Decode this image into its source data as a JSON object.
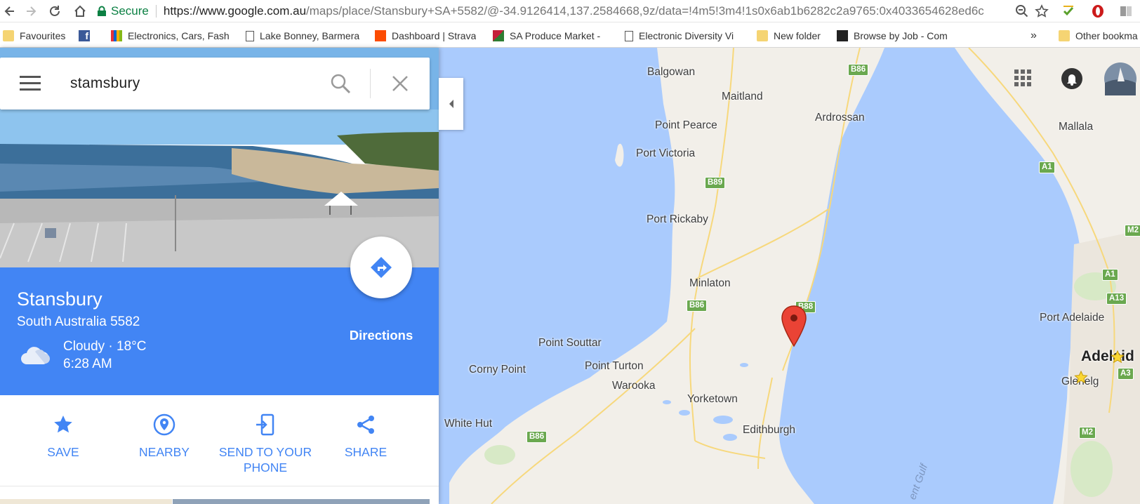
{
  "browser": {
    "url_secure_label": "Secure",
    "url_host": "https://www.google.com.au",
    "url_path": "/maps/place/Stansbury+SA+5582/@-34.9126414,137.2584668,9z/data=!4m5!3m4!1s0x6ab1b6282c2a9765:0x4033654628ed6c",
    "bookmarks": [
      {
        "label": "Favourites",
        "icon": "folder-icon"
      },
      {
        "label": "",
        "icon": "facebook-icon"
      },
      {
        "label": "Electronics, Cars, Fash",
        "icon": "ebay-icon"
      },
      {
        "label": "Lake Bonney, Barmera",
        "icon": "page-icon"
      },
      {
        "label": "Dashboard | Strava",
        "icon": "strava-icon"
      },
      {
        "label": "SA Produce Market - ",
        "icon": "produce-market-icon"
      },
      {
        "label": "Electronic Diversity Vi",
        "icon": "page-icon"
      },
      {
        "label": "New folder",
        "icon": "folder-icon"
      },
      {
        "label": "Browse by Job - Com",
        "icon": "job-site-icon"
      }
    ],
    "overflow_label": "»",
    "other_bookmarks": "Other bookma"
  },
  "search": {
    "query": "stamsbury"
  },
  "place": {
    "name": "Stansbury",
    "subtitle": "South Australia 5582",
    "weather_condition": "Cloudy · 18°C",
    "weather_time": "6:28 AM",
    "directions_label": "Directions"
  },
  "actions": [
    {
      "label": "SAVE",
      "icon": "star-icon"
    },
    {
      "label": "NEARBY",
      "icon": "nearby-pin-icon"
    },
    {
      "label": "SEND TO YOUR PHONE",
      "icon": "send-to-phone-icon"
    },
    {
      "label": "SHARE",
      "icon": "share-icon"
    }
  ],
  "map": {
    "towns": [
      "Balgowan",
      "Maitland",
      "Ardrossan",
      "Point Pearce",
      "Port Victoria",
      "Mallala",
      "Port Rickaby",
      "Minlaton",
      "Point Souttar",
      "Corny Point",
      "Point Turton",
      "Warooka",
      "Yorketown",
      "Edithburgh",
      "White Hut",
      "Port Adelaide",
      "Glenelg"
    ],
    "city": "Adelaid",
    "road_shields": [
      "B86",
      "B89",
      "B88",
      "B86",
      "B86",
      "A1",
      "A1",
      "A13",
      "A3",
      "M2",
      "M2"
    ],
    "water_label": "ent Gulf"
  },
  "colors": {
    "accent": "#4285f4",
    "water": "#aacbfd",
    "land": "#f2efe9",
    "road_shield": "#6aa84f",
    "pin": "#ea4335"
  }
}
